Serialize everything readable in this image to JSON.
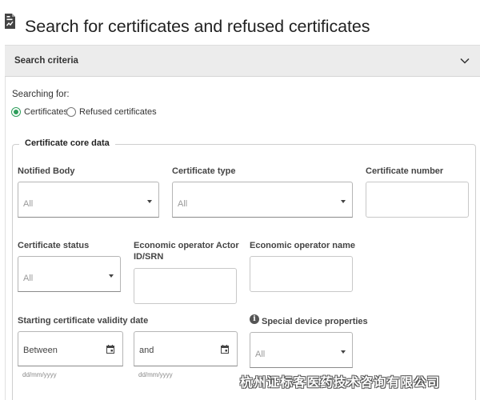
{
  "page": {
    "title": "Search for certificates and refused certificates"
  },
  "criteria": {
    "label": "Search criteria",
    "toggle_icon": "chevron-down-icon"
  },
  "searching_for": {
    "label": "Searching for:",
    "options": [
      {
        "label": "Certificates",
        "checked": true
      },
      {
        "label": "Refused certificates",
        "checked": false
      }
    ]
  },
  "core_data": {
    "legend": "Certificate core data",
    "notified_body": {
      "label": "Notified Body",
      "value": "All"
    },
    "certificate_type": {
      "label": "Certificate type",
      "value": "All"
    },
    "certificate_number": {
      "label": "Certificate number",
      "value": ""
    },
    "certificate_status": {
      "label": "Certificate status",
      "value": "All"
    },
    "actor_id": {
      "label_line1": "Economic operator Actor",
      "label_line2": "ID/SRN",
      "value": ""
    },
    "operator_name": {
      "label": "Economic operator name",
      "value": ""
    },
    "validity_date": {
      "label": "Starting certificate validity date",
      "from_value": "Between",
      "to_value": "and",
      "hint": "dd/mm/yyyy"
    },
    "special_properties": {
      "label": "Special device properties",
      "value": "All",
      "info_icon": "info-icon"
    }
  },
  "watermark": {
    "text": "杭州证标客医药技术咨询有限公司"
  },
  "colors": {
    "accent_green": "#2e9e5b",
    "criteria_bar": "#ececec"
  }
}
